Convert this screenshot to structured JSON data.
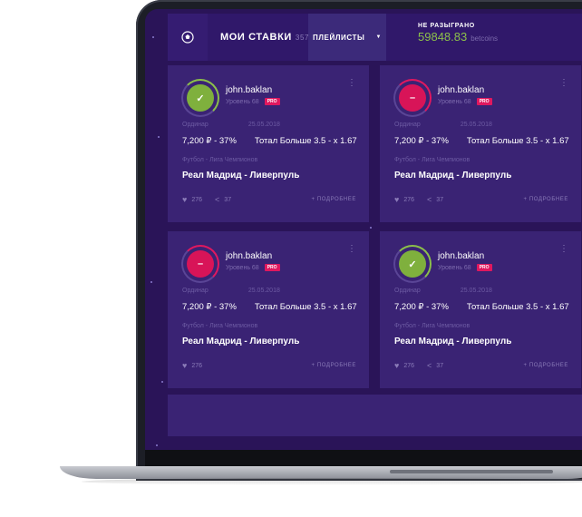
{
  "header": {
    "title": "МОИ СТАВКИ",
    "count": "357",
    "playlists_label": "ПЛЕЙЛИСТЫ",
    "balance_label": "НЕ РАЗЫГРАНО",
    "balance_value": "59848.83",
    "balance_unit": "betcoins"
  },
  "colors": {
    "win": "#7fb03d",
    "loss": "#d81458",
    "accent_green": "#8cc04a"
  },
  "cards": [
    {
      "status": "win",
      "status_icon": "check-icon",
      "user": "john.baklan",
      "level": "Уровень 68",
      "badge": "PRO",
      "type": "Ординар",
      "date": "25.05.2018",
      "odds": "7,200 ₽ - 37%",
      "bet": "Тотал Больше 3.5 - x 1.67",
      "league": "Футбол - Лига Чемпионов",
      "match": "Реал Мадрид - Ливерпуль",
      "likes": "276",
      "shares": "37",
      "more": "ПОДРОБНЕЕ"
    },
    {
      "status": "loss",
      "status_icon": "minus-icon",
      "user": "john.baklan",
      "level": "Уровень 68",
      "badge": "PRO",
      "type": "Ординар",
      "date": "25.05.2018",
      "odds": "7,200 ₽ - 37%",
      "bet": "Тотал Больше 3.5 - x 1.67",
      "league": "Футбол - Лига Чемпионов",
      "match": "Реал Мадрид - Ливерпуль",
      "likes": "276",
      "shares": "37",
      "more": "ПОДРОБНЕЕ"
    },
    {
      "status": "loss",
      "status_icon": "minus-icon",
      "user": "john.baklan",
      "level": "Уровень 68",
      "badge": "PRO",
      "type": "Ординар",
      "date": "25.05.2018",
      "odds": "7,200 ₽ - 37%",
      "bet": "Тотал Больше 3.5 - x 1.67",
      "league": "Футбол - Лига Чемпионов",
      "match": "Реал Мадрид - Ливерпуль",
      "likes": "276",
      "shares": "",
      "more": "ПОДРОБНЕЕ"
    },
    {
      "status": "win",
      "status_icon": "check-icon",
      "user": "john.baklan",
      "level": "Уровень 68",
      "badge": "PRO",
      "type": "Ординар",
      "date": "25.05.2018",
      "odds": "7,200 ₽ - 37%",
      "bet": "Тотал Больше 3.5 - x 1.67",
      "league": "Футбол - Лига Чемпионов",
      "match": "Реал Мадрид - Ливерпуль",
      "likes": "276",
      "shares": "37",
      "more": "ПОДРОБНЕЕ"
    }
  ]
}
